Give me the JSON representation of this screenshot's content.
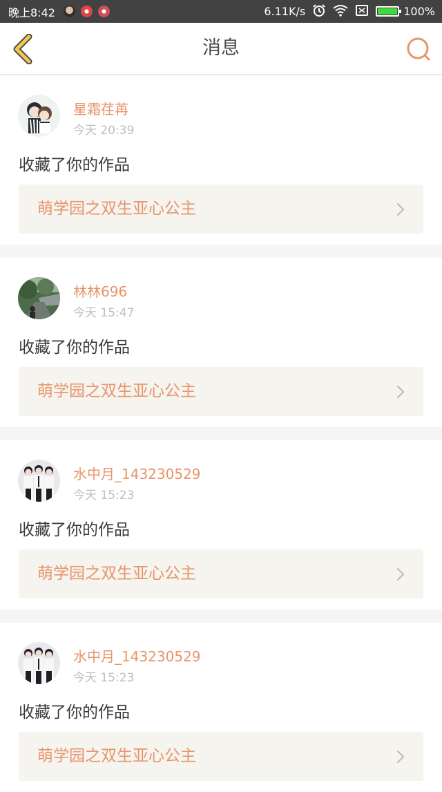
{
  "status_bar": {
    "time": "晚上8:42",
    "net_speed": "6.11K/s",
    "battery_label": "100%",
    "battery_level": 1.0,
    "notification_icons": [
      "avatar-notification-icon",
      "app-notification-icon",
      "app-notification-icon"
    ],
    "icons": [
      "alarm-icon",
      "wifi-icon",
      "cast-icon",
      "battery-icon"
    ]
  },
  "nav": {
    "title": "消息",
    "back_icon": "chevron-left-icon",
    "search_icon": "search-icon"
  },
  "colors": {
    "accent": "#e8956a",
    "back_arrow": "#f2c94c",
    "back_arrow_outline": "#4a4a4a",
    "card_bg": "#f5f4ef",
    "divider": "#f6f4f4",
    "status_bar": "#424242"
  },
  "messages": [
    {
      "user": "星霜荏苒",
      "time": "今天 20:39",
      "action": "收藏了你的作品",
      "work_title": "萌学园之双生亚心公主",
      "avatar": "anime-couple-avatar"
    },
    {
      "user": "林林696",
      "time": "今天 15:47",
      "action": "收藏了你的作品",
      "work_title": "萌学园之双生亚心公主",
      "avatar": "forest-path-avatar"
    },
    {
      "user": "水中月_143230529",
      "time": "今天 15:23",
      "action": "收藏了你的作品",
      "work_title": "萌学园之双生亚心公主",
      "avatar": "group-photo-avatar"
    },
    {
      "user": "水中月_143230529",
      "time": "今天 15:23",
      "action": "收藏了你的作品",
      "work_title": "萌学园之双生亚心公主",
      "avatar": "group-photo-avatar"
    }
  ]
}
